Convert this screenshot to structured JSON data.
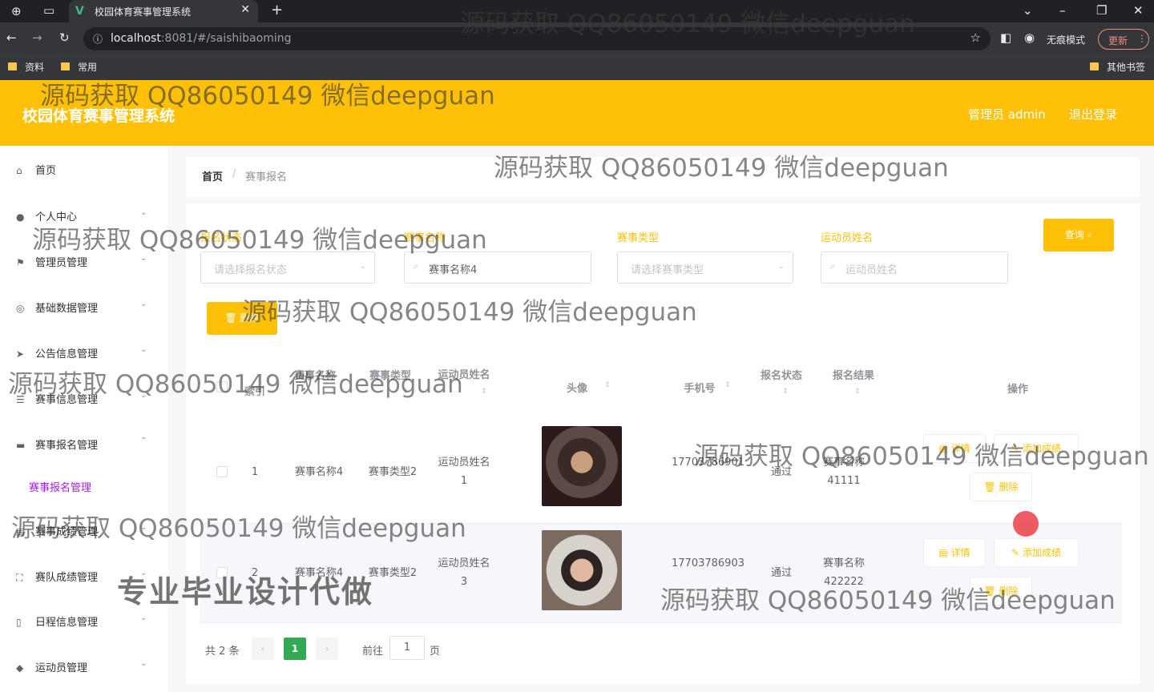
{
  "browser": {
    "tab_title": "校园体育赛事管理系统",
    "url_host": "localhost",
    "url_rest": ":8081/#/saishibaoming",
    "incognito_label": "无痕模式",
    "update_label": "更新",
    "bookmarks": [
      "资料",
      "常用"
    ],
    "other_bookmarks": "其他书签"
  },
  "header": {
    "title": "校园体育赛事管理系统",
    "user": "管理员 admin",
    "logout": "退出登录"
  },
  "sidebar": {
    "items": [
      {
        "label": "首页",
        "icon": "home-icon"
      },
      {
        "label": "个人中心",
        "icon": "user-icon"
      },
      {
        "label": "管理员管理",
        "icon": "flag-icon"
      },
      {
        "label": "基础数据管理",
        "icon": "settings-icon"
      },
      {
        "label": "公告信息管理",
        "icon": "send-icon"
      },
      {
        "label": "赛事信息管理",
        "icon": "sliders-icon"
      },
      {
        "label": "赛事报名管理",
        "icon": "monitor-icon"
      },
      {
        "label": "赛事报名管理",
        "icon": ""
      },
      {
        "label": "赛事成绩管理",
        "icon": "chart-icon"
      },
      {
        "label": "赛队成绩管理",
        "icon": "frame-icon"
      },
      {
        "label": "日程信息管理",
        "icon": "phone-icon"
      },
      {
        "label": "运动员管理",
        "icon": "location-icon"
      }
    ]
  },
  "breadcrumb": {
    "home": "首页",
    "sep": "/",
    "current": "赛事报名"
  },
  "filters": {
    "status_label": "报名状态",
    "status_placeholder": "请选择报名状态",
    "name_label": "赛事名称",
    "name_value": "赛事名称4",
    "type_label": "赛事类型",
    "type_placeholder": "请选择赛事类型",
    "athlete_label": "运动员姓名",
    "athlete_placeholder": "运动员姓名",
    "search_button": "查询",
    "delete_button": "删除"
  },
  "table": {
    "headers": [
      "索引",
      "赛事名称",
      "赛事类型",
      "运动员姓名",
      "头像",
      "手机号",
      "报名状态",
      "报名结果",
      "操作"
    ],
    "rows": [
      {
        "index": "1",
        "name": "赛事名称4",
        "type": "赛事类型2",
        "athlete": "运动员姓名1",
        "phone": "17703786901",
        "status": "通过",
        "result": "赛事名称41111"
      },
      {
        "index": "2",
        "name": "赛事名称4",
        "type": "赛事类型2",
        "athlete": "运动员姓名3",
        "phone": "17703786903",
        "status": "通过",
        "result": "赛事名称422222"
      }
    ],
    "actions": {
      "detail": "详情",
      "add_score": "添加成绩",
      "delete": "删除"
    }
  },
  "pagination": {
    "total": "共 2 条",
    "current": "1",
    "goto": "前往",
    "page_input": "1",
    "page_unit": "页"
  },
  "watermarks": {
    "text": "源码获取 QQ86050149 微信deepguan",
    "big": "专业毕业设计代做"
  },
  "colors": {
    "accent": "#ffc107",
    "pager_active": "#34a853"
  }
}
